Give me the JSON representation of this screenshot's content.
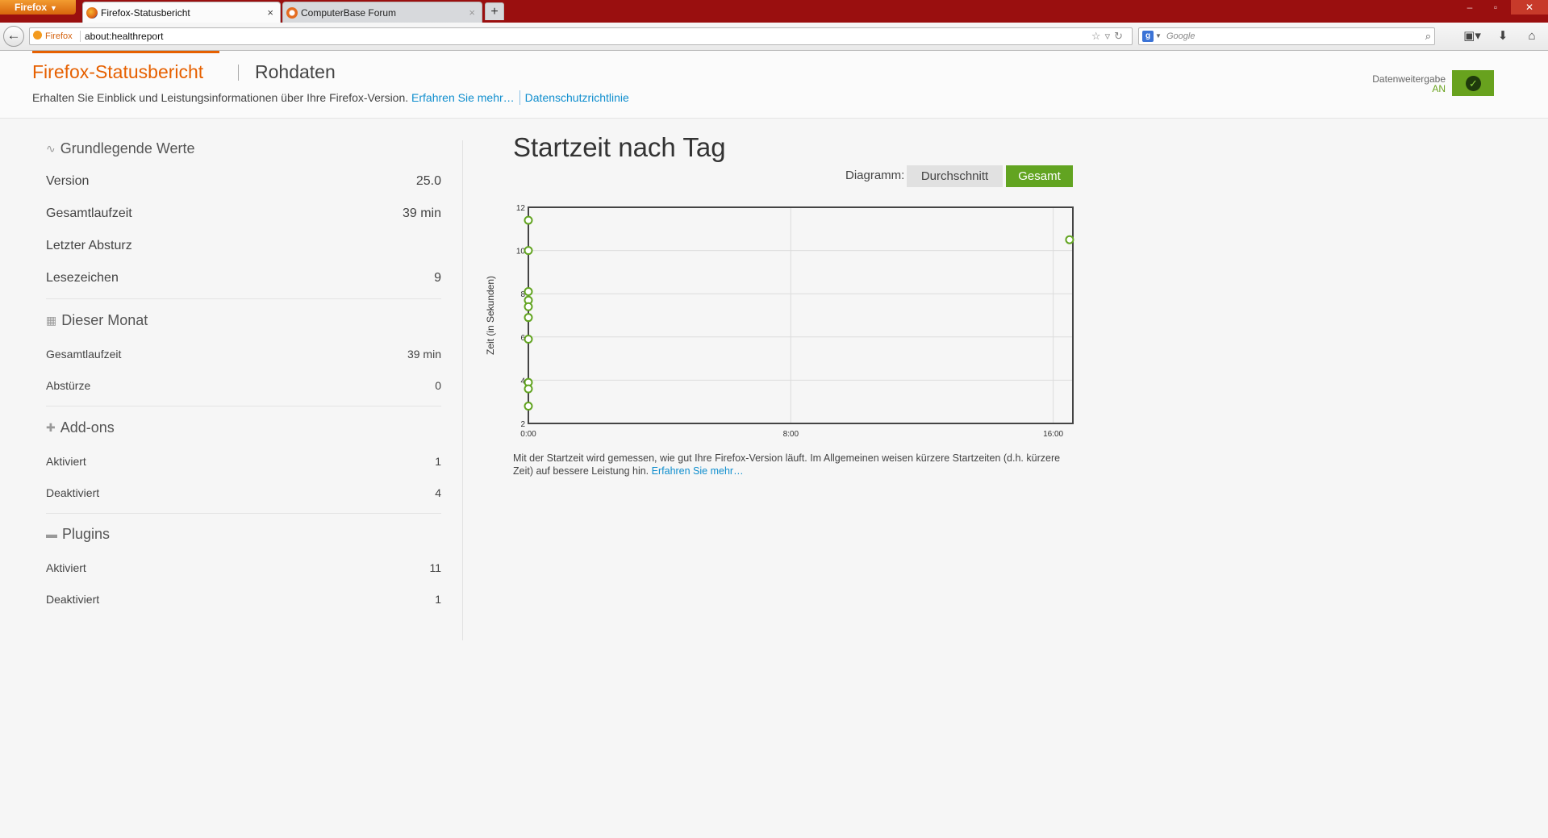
{
  "browser": {
    "menu_label": "Firefox",
    "tabs": [
      {
        "label": "Firefox-Statusbericht",
        "active": true
      },
      {
        "label": "ComputerBase Forum",
        "active": false
      }
    ],
    "new_tab": "+",
    "identity_label": "Firefox",
    "url": "about:healthreport",
    "search_placeholder": "Google"
  },
  "header": {
    "title": "Firefox-Statusbericht",
    "raw_data": "Rohdaten",
    "subtitle": "Erhalten Sie Einblick und Leistungsinformationen über Ihre Firefox-Version.",
    "learn_more": "Erfahren Sie mehr…",
    "privacy": "Datenschutzrichtlinie",
    "share_label": "Datenweitergabe",
    "share_state": "AN",
    "accent": "#e66000",
    "link_color": "#0f8ece",
    "toggle_color": "#68a21e"
  },
  "sidebar": {
    "basics": {
      "heading": "Grundlegende Werte",
      "icon": "pulse-icon",
      "rows": [
        {
          "label": "Version",
          "value": "25.0"
        },
        {
          "label": "Gesamtlaufzeit",
          "value": "39 min"
        },
        {
          "label": "Letzter Absturz",
          "value": ""
        },
        {
          "label": "Lesezeichen",
          "value": "9"
        }
      ]
    },
    "month": {
      "heading": "Dieser Monat",
      "icon": "calendar-icon",
      "rows": [
        {
          "label": "Gesamtlaufzeit",
          "value": "39 min"
        },
        {
          "label": "Abstürze",
          "value": "0"
        }
      ]
    },
    "addons": {
      "heading": "Add-ons",
      "icon": "puzzle-icon",
      "rows": [
        {
          "label": "Aktiviert",
          "value": "1"
        },
        {
          "label": "Deaktiviert",
          "value": "4"
        }
      ]
    },
    "plugins": {
      "heading": "Plugins",
      "icon": "plugin-icon",
      "rows": [
        {
          "label": "Aktiviert",
          "value": "11"
        },
        {
          "label": "Deaktiviert",
          "value": "1"
        }
      ]
    }
  },
  "main": {
    "title": "Startzeit nach Tag",
    "diagram_label": "Diagramm:",
    "btn_average": "Durchschnitt",
    "btn_total": "Gesamt",
    "description": "Mit der Startzeit wird gemessen, wie gut Ihre Firefox-Version läuft. Im Allgemeinen weisen kürzere Startzeiten (d.h. kürzere Zeit) auf bessere Leistung hin.",
    "description_link": "Erfahren Sie mehr…"
  },
  "chart_data": {
    "type": "scatter",
    "title": "",
    "xlabel": "",
    "ylabel": "Zeit (in Sekunden)",
    "x_ticks": [
      "0:00",
      "8:00",
      "16:00"
    ],
    "y_ticks": [
      2,
      4,
      6,
      8,
      10,
      12
    ],
    "xlim": [
      0,
      16.6
    ],
    "ylim": [
      2,
      12
    ],
    "grid": true,
    "point_color": "#62a421",
    "points": [
      {
        "x": 0,
        "y": 11.4
      },
      {
        "x": 0,
        "y": 10.0
      },
      {
        "x": 0,
        "y": 8.1
      },
      {
        "x": 0,
        "y": 7.7
      },
      {
        "x": 0,
        "y": 7.4
      },
      {
        "x": 0,
        "y": 6.9
      },
      {
        "x": 0,
        "y": 5.9
      },
      {
        "x": 0,
        "y": 3.9
      },
      {
        "x": 0,
        "y": 3.6
      },
      {
        "x": 0,
        "y": 2.8
      },
      {
        "x": 16.5,
        "y": 10.5
      }
    ]
  }
}
